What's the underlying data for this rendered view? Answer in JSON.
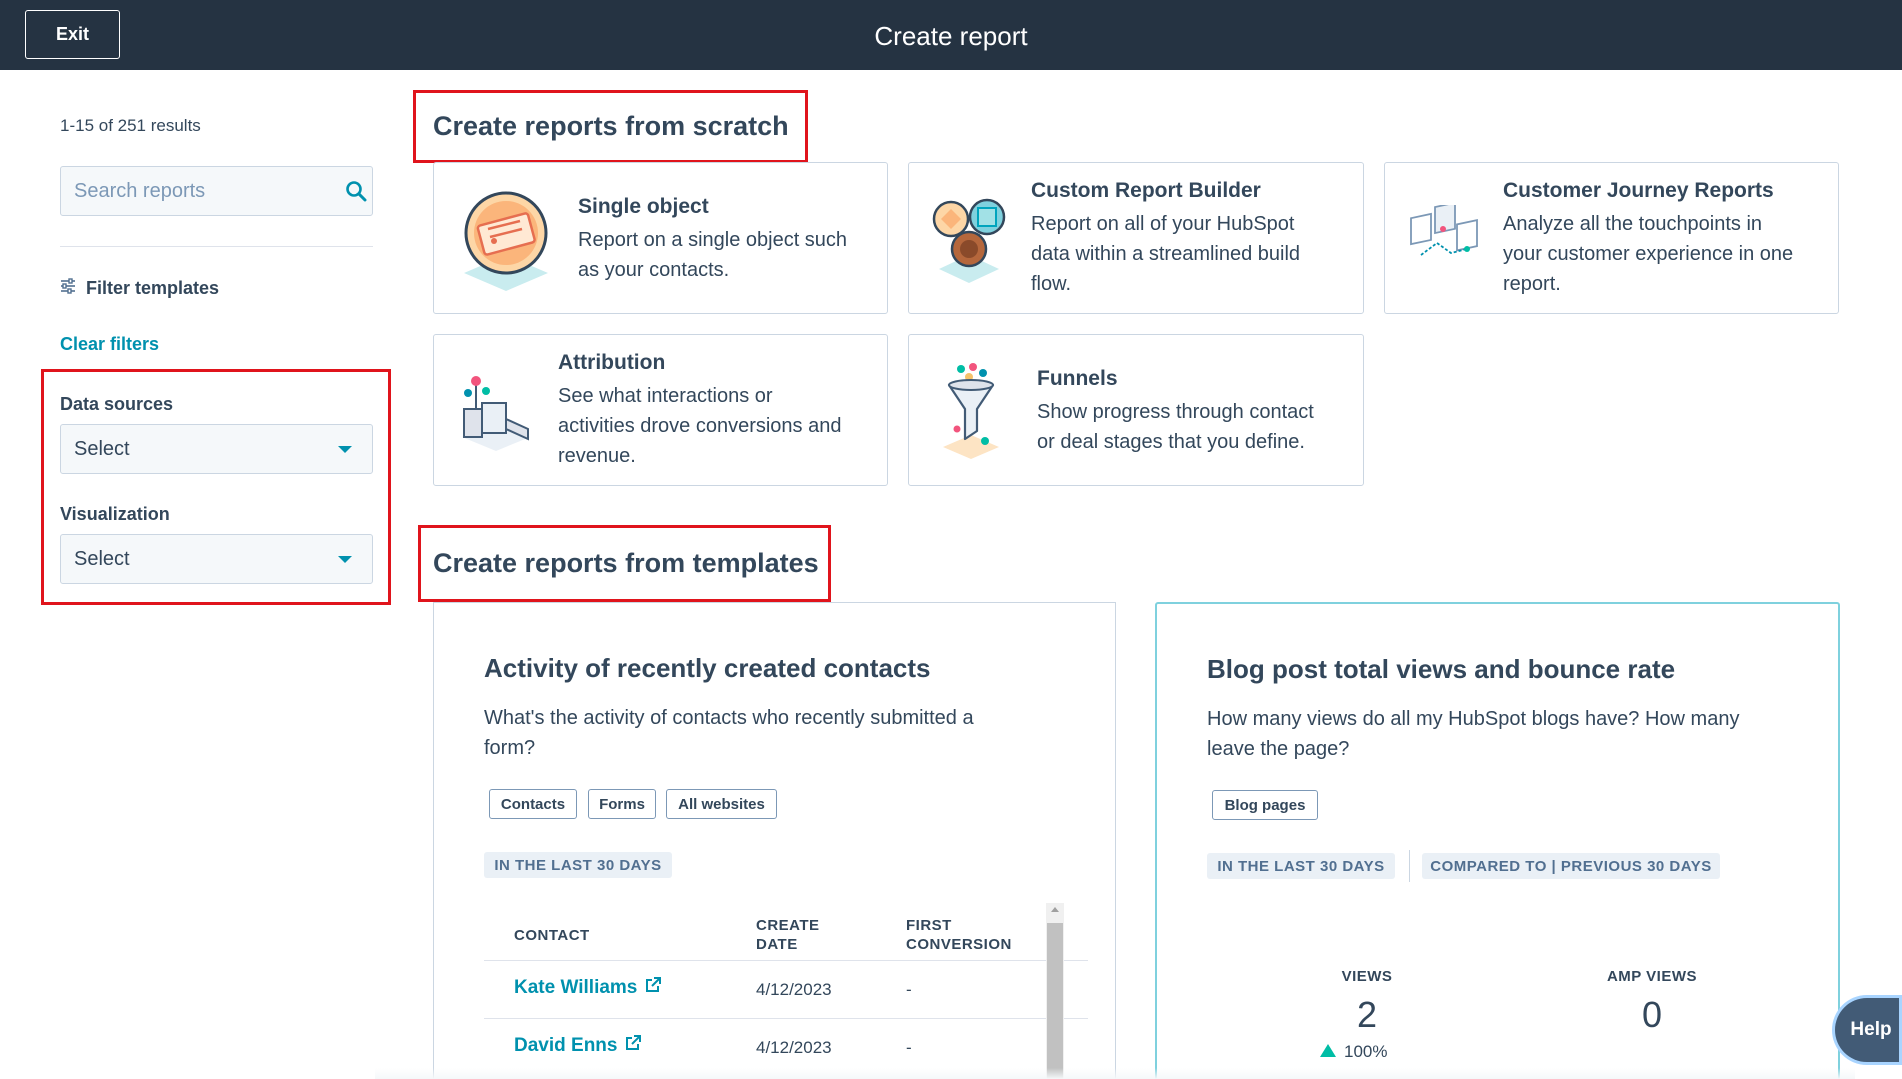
{
  "topbar": {
    "exit_label": "Exit",
    "title": "Create report"
  },
  "sidebar": {
    "results_count": "1-15 of 251 results",
    "search_placeholder": "Search reports",
    "filter_templates_label": "Filter templates",
    "clear_filters_label": "Clear filters",
    "data_sources": {
      "label": "Data sources",
      "value": "Select"
    },
    "visualization": {
      "label": "Visualization",
      "value": "Select"
    }
  },
  "scratch": {
    "heading": "Create reports from scratch",
    "cards": [
      {
        "title": "Single object",
        "description": [
          "Report on a single object such",
          "as your contacts."
        ],
        "icon": "single-object-icon"
      },
      {
        "title": "Custom Report Builder",
        "description": [
          "Report on all of your HubSpot",
          "data within a streamlined build",
          "flow."
        ],
        "icon": "custom-report-builder-icon"
      },
      {
        "title": "Customer Journey Reports",
        "description": [
          "Analyze all the touchpoints in",
          "your customer experience in one",
          "report."
        ],
        "icon": "customer-journey-icon"
      },
      {
        "title": "Attribution",
        "description": [
          "See what interactions or",
          "activities drove conversions and",
          "revenue."
        ],
        "icon": "attribution-icon"
      },
      {
        "title": "Funnels",
        "description": [
          "Show progress through contact",
          "or deal stages that you define."
        ],
        "icon": "funnel-icon"
      }
    ]
  },
  "templates": {
    "heading": "Create reports from templates",
    "cards": [
      {
        "title": "Activity of recently created contacts",
        "description": [
          "What's the activity of contacts who recently submitted a",
          "form?"
        ],
        "tags": [
          "Contacts",
          "Forms",
          "All websites"
        ],
        "chips": [
          "IN THE LAST 30 DAYS"
        ],
        "table": {
          "columns": [
            [
              "CONTACT"
            ],
            [
              "CREATE",
              "DATE"
            ],
            [
              "FIRST",
              "CONVERSION"
            ]
          ],
          "rows": [
            {
              "contact": "Kate Williams",
              "create_date": "4/12/2023",
              "first_conversion": "-"
            },
            {
              "contact": "David Enns",
              "create_date": "4/12/2023",
              "first_conversion": "-"
            }
          ]
        }
      },
      {
        "title": "Blog post total views and bounce rate",
        "description": [
          "How many views do all my HubSpot blogs have? How many",
          "leave the page?"
        ],
        "tags": [
          "Blog pages"
        ],
        "chips": [
          "IN THE LAST 30 DAYS",
          "COMPARED TO | PREVIOUS 30 DAYS"
        ],
        "kpis": [
          {
            "label": "VIEWS",
            "value": "2",
            "change": "100%"
          },
          {
            "label": "AMP VIEWS",
            "value": "0"
          }
        ]
      }
    ]
  },
  "help_label": "Help",
  "colors": {
    "topbar": "#253342",
    "link": "#0091ae",
    "highlight_box": "#e0141c",
    "text": "#33475b"
  }
}
